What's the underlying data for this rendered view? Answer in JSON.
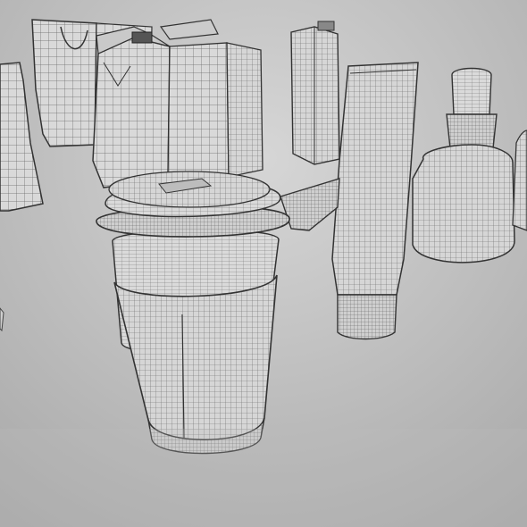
{
  "scene": {
    "kind": "3d-wireframe-render",
    "background": "#b9b9b9",
    "mesh_fill": "#d9d9d9",
    "wire_color": "#5a5a5a",
    "edge_color": "#2e2e2e"
  },
  "objects": [
    {
      "name": "pouch",
      "icon": "pouch-wireframe"
    },
    {
      "name": "paper-bag",
      "icon": "bag-wireframe"
    },
    {
      "name": "gable-carton-large",
      "icon": "carton-wireframe"
    },
    {
      "name": "juice-carton-small",
      "icon": "carton-wireframe"
    },
    {
      "name": "squeeze-tube",
      "icon": "tube-wireframe"
    },
    {
      "name": "dropper-bottle",
      "icon": "bottle-wireframe"
    },
    {
      "name": "paper-cup-with-lid",
      "icon": "cup-wireframe"
    },
    {
      "name": "clip-tag",
      "icon": "clip-wireframe"
    }
  ]
}
